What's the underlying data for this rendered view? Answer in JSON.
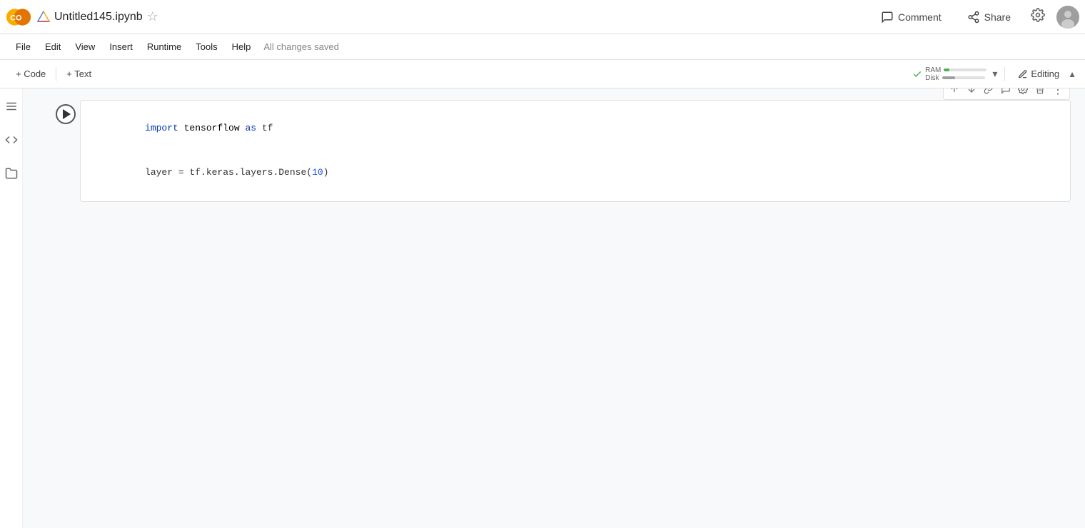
{
  "app": {
    "logo_text": "CO",
    "file_name": "Untitled145.ipynb",
    "saved_status": "All changes saved"
  },
  "menu": {
    "items": [
      "File",
      "Edit",
      "View",
      "Insert",
      "Runtime",
      "Tools",
      "Help"
    ]
  },
  "toolbar": {
    "add_code_label": "+ Code",
    "add_text_label": "+ Text",
    "ram_label": "RAM",
    "disk_label": "Disk",
    "editing_label": "Editing"
  },
  "header_right": {
    "comment_label": "Comment",
    "share_label": "Share"
  },
  "cell": {
    "line1": "import tensorflow as tf",
    "line2": "layer = tf.keras.layers.Dense(10)"
  },
  "cell_tools": {
    "move_up": "↑",
    "move_down": "↓",
    "link": "🔗",
    "comment": "💬",
    "settings": "⚙",
    "delete": "🗑",
    "more": "⋮"
  }
}
